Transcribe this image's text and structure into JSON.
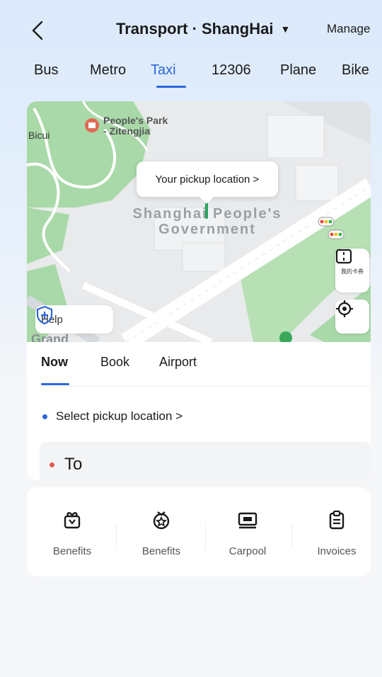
{
  "header": {
    "title": "Transport · ShangHai",
    "manage_label": "Manage"
  },
  "tabs": [
    {
      "label": "Bus",
      "active": false
    },
    {
      "label": "Metro",
      "active": false
    },
    {
      "label": "Taxi",
      "active": true
    },
    {
      "label": "12306",
      "active": false
    },
    {
      "label": "Plane",
      "active": false
    },
    {
      "label": "Bike",
      "active": false
    }
  ],
  "map": {
    "poi_park": "People's Park",
    "poi_park_sub": "- Zitengjia",
    "poi_left": "Bicui",
    "poi_bottom": "i Grand",
    "gov_line1": "Shanghai People's",
    "gov_line2": "Government",
    "pickup_bubble": "Your pickup location >",
    "coupon_small": "我的卡券",
    "help_label": "Help"
  },
  "ride_modes": [
    {
      "label": "Now",
      "active": true
    },
    {
      "label": "Book",
      "active": false
    },
    {
      "label": "Airport",
      "active": false
    }
  ],
  "pickup": {
    "label": "Select pickup location >"
  },
  "destination": {
    "label": "To"
  },
  "services": [
    {
      "label": "Benefits",
      "icon": "gift-box-icon"
    },
    {
      "label": "Benefits",
      "icon": "coupon-medal-icon"
    },
    {
      "label": "Carpool",
      "icon": "carpool-ticket-icon"
    },
    {
      "label": "Invoices",
      "icon": "clipboard-icon"
    }
  ],
  "colors": {
    "accent": "#2c67d8",
    "pickup_dot": "#2c67d8",
    "dest_dot": "#e45b4f",
    "park_green": "#a9d9a8"
  }
}
